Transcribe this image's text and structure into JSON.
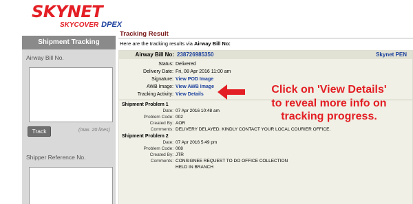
{
  "logo": {
    "brand": "SKYNET",
    "sub_left": "SKYCOVER",
    "sub_right": "DPEX"
  },
  "sidebar": {
    "header": "Shipment Tracking",
    "awb_label": "Airway Bill No.",
    "awb_value": "",
    "track_button": "Track",
    "max_hint": "(max. 20 lines)",
    "ref_label": "Shipper Reference No.",
    "ref_value": ""
  },
  "main": {
    "title": "Tracking Result",
    "intro_prefix": "Here are the tracking results via",
    "intro_bold": "Airway Bill No:",
    "awb_label": "Airway Bill No:",
    "awb_number": "238726985350",
    "carrier": "Skynet PEN",
    "details": [
      {
        "key": "Status:",
        "value": "Delivered",
        "link": false
      },
      {
        "key": "Delivery Date:",
        "value": "Fri, 08 Apr 2016 11:00 am",
        "link": false
      },
      {
        "key": "Signature:",
        "value": "View POD Image",
        "link": true
      },
      {
        "key": "AWB Image:",
        "value": "View AWB Image",
        "link": true
      },
      {
        "key": "Tracking Activity:",
        "value": "View Details",
        "link": true
      }
    ],
    "problems": [
      {
        "title": "Shipment Problem 1",
        "rows": [
          {
            "key": "Date:",
            "value": "07 Apr 2016 10:48 am"
          },
          {
            "key": "Problem Code:",
            "value": "002"
          },
          {
            "key": "Created By:",
            "value": "AOR"
          },
          {
            "key": "Comments:",
            "value": "DELIVERY DELAYED. KINDLY CONTACT YOUR LOCAL COURIER OFFICE."
          }
        ]
      },
      {
        "title": "Shipment Problem 2",
        "rows": [
          {
            "key": "Date:",
            "value": "07 Apr 2016 5:49 pm"
          },
          {
            "key": "Problem Code:",
            "value": "008"
          },
          {
            "key": "Created By:",
            "value": "JTR"
          },
          {
            "key": "Comments:",
            "value": "CONSIGNEE REQUEST TO DO OFFICE COLLECTION"
          },
          {
            "key": "",
            "value": "HELD IN BRANCH"
          }
        ]
      }
    ]
  },
  "annotation": {
    "lines": [
      "Click on 'View Details'",
      "to reveal more info on",
      "tracking progress."
    ],
    "color": "#e31e24"
  },
  "colors": {
    "brand_red": "#e31e24",
    "link_blue": "#1a3f9c",
    "sidebar_bg": "#d9d9d9",
    "sidebar_head": "#8a8a8a",
    "result_bg": "#f0f0e6"
  }
}
